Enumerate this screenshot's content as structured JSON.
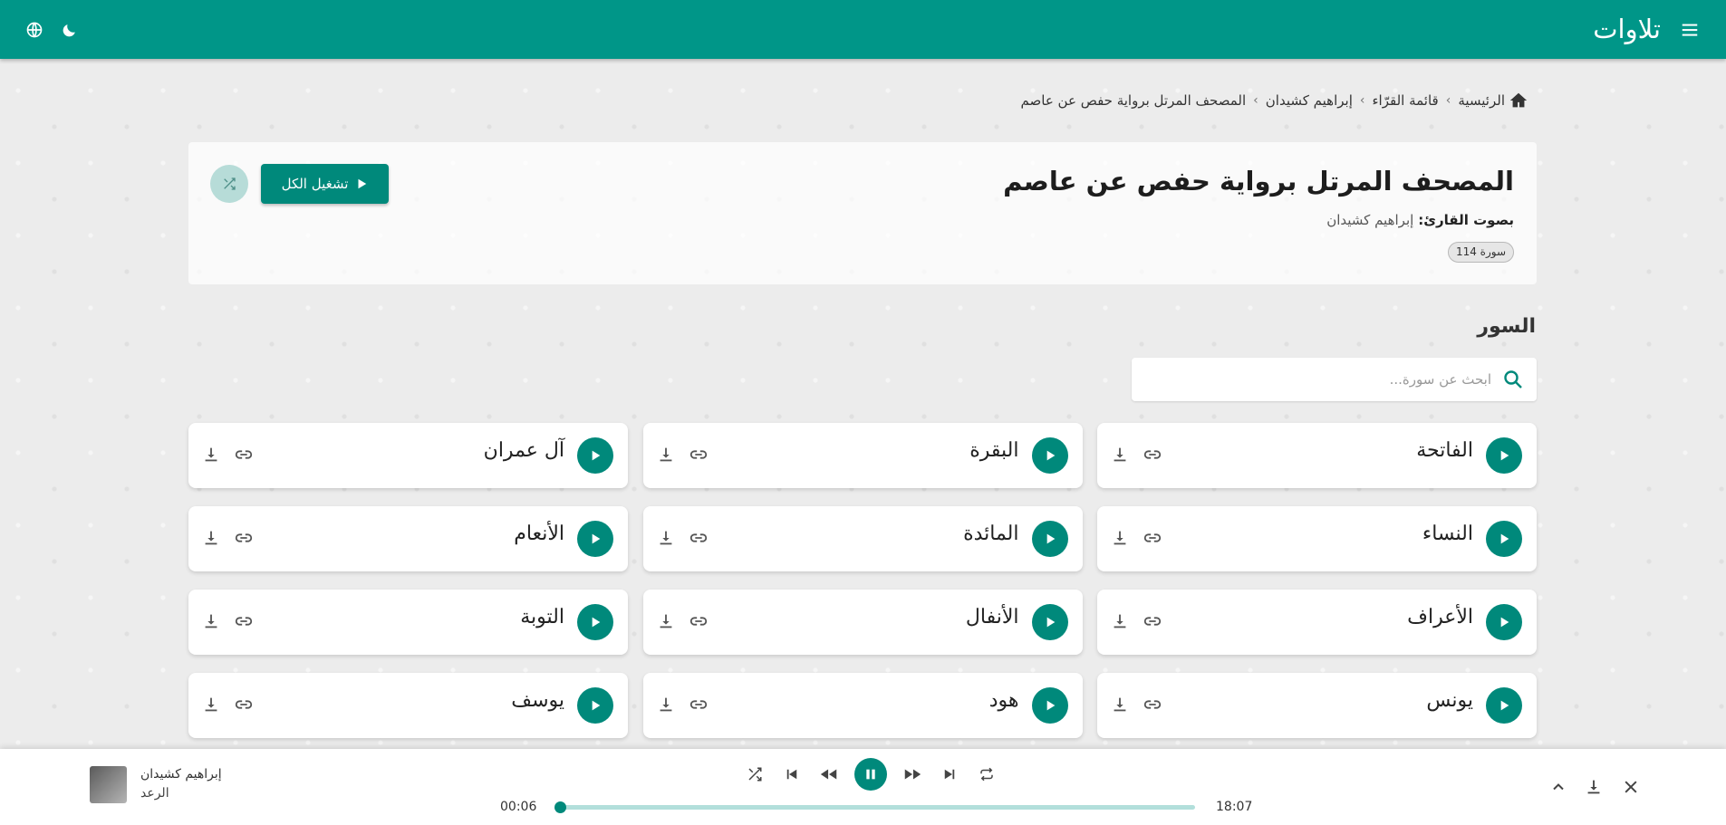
{
  "app": {
    "logo_text": "تلاوات"
  },
  "breadcrumb": [
    {
      "label": "الرئيسية"
    },
    {
      "label": "قائمة القرّاء"
    },
    {
      "label": "إبراهيم كشيدان"
    },
    {
      "label": "المصحف المرتل برواية حفص عن عاصم"
    }
  ],
  "hero": {
    "title": "المصحف المرتل برواية حفص عن عاصم",
    "reciter_label": "بصوت القارئ:",
    "reciter_name": "إبراهيم كشيدان",
    "chip": "114 سورة",
    "play_all": "تشغيل الكل"
  },
  "section": {
    "title": "السور",
    "search_placeholder": "ابحث عن سورة..."
  },
  "surahs": [
    "الفاتحة",
    "البقرة",
    "آل عمران",
    "النساء",
    "المائدة",
    "الأنعام",
    "الأعراف",
    "الأنفال",
    "التوبة",
    "يونس",
    "هود",
    "يوسف"
  ],
  "player": {
    "reciter": "إبراهيم كشيدان",
    "surah": "الرعد",
    "current_time": "00:06",
    "duration": "18:07",
    "progress": 0.006
  },
  "colors": {
    "primary": "#009688",
    "accent": "#00897b",
    "track": "#b2dfdb"
  },
  "icons": {
    "menu": "menu-icon",
    "globe": "globe-icon",
    "theme": "moon-icon",
    "home": "home-icon",
    "search": "search-icon",
    "play": "play-icon",
    "link": "link-icon",
    "download": "download-icon",
    "shuffle": "shuffle-icon",
    "pause": "pause-icon",
    "repeat": "repeat-icon",
    "close": "close-icon"
  }
}
